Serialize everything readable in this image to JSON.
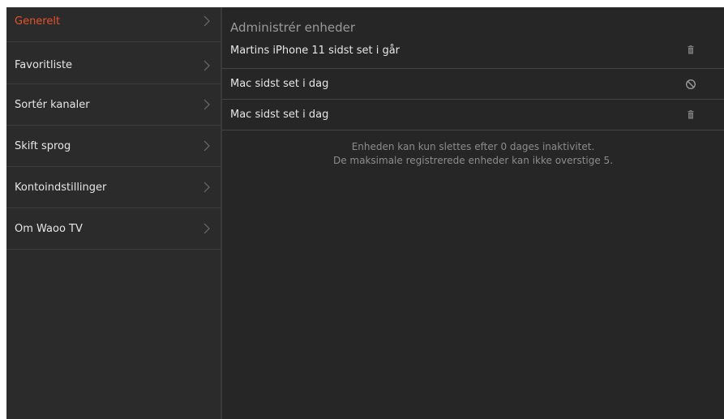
{
  "colors": {
    "accent": "#e5532c",
    "background": "#262626",
    "sidebar": "#2b2b2b",
    "text": "#e6e6e6",
    "muted": "#8c8c8c"
  },
  "sidebar": {
    "items": [
      {
        "label": "Generelt",
        "active": true,
        "icon": "chevron-right-icon"
      },
      {
        "label": "Favoritliste",
        "active": false,
        "icon": "chevron-right-icon"
      },
      {
        "label": "Sortér kanaler",
        "active": false,
        "icon": "chevron-right-icon"
      },
      {
        "label": "Skift sprog",
        "active": false,
        "icon": "chevron-right-icon"
      },
      {
        "label": "Kontoindstillinger",
        "active": false,
        "icon": "chevron-right-icon"
      },
      {
        "label": "Om Waoo TV",
        "active": false,
        "icon": "chevron-right-icon"
      }
    ]
  },
  "main": {
    "title": "Administrér enheder",
    "devices": [
      {
        "name": "Martins iPhone 11 sidst set i går",
        "action_icon": "trash-icon"
      },
      {
        "name": "Mac sidst set i dag",
        "action_icon": "block-icon"
      },
      {
        "name": "Mac sidst set i dag",
        "action_icon": "trash-icon"
      }
    ],
    "info_line_1": "Enheden kan kun slettes efter 0 dages inaktivitet.",
    "info_line_2": "De maksimale registrerede enheder kan ikke overstige 5."
  }
}
